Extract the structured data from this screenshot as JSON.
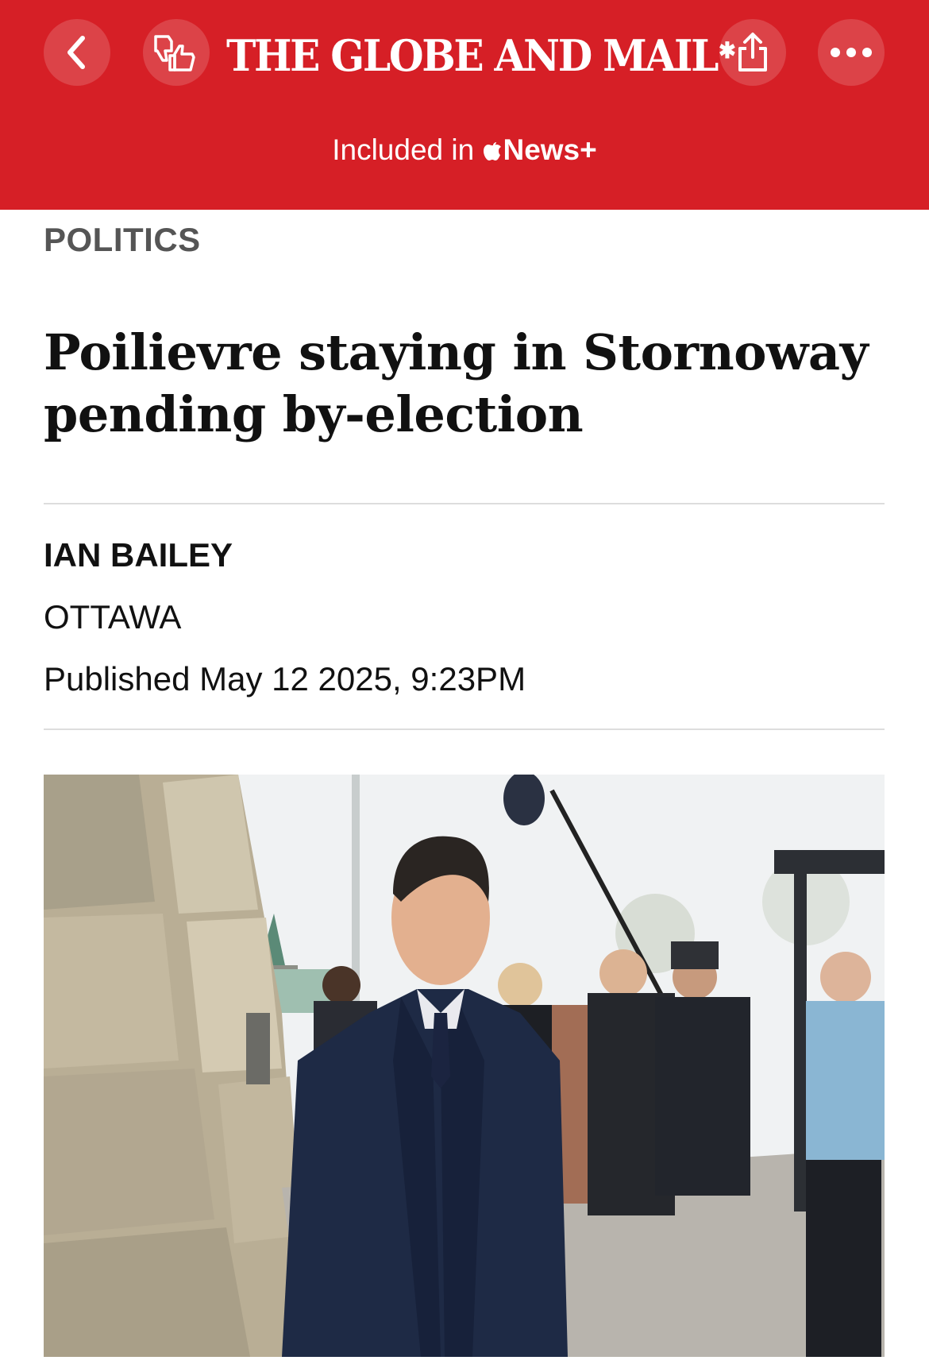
{
  "header": {
    "masthead": "THE GLOBE AND MAIL",
    "included_text": "Included in",
    "included_brand": "News+",
    "brand_color": "#d61f26",
    "icons": [
      "chevron-left-icon",
      "thumbs-reaction-icon",
      "share-icon",
      "more-icon"
    ]
  },
  "article": {
    "category": "POLITICS",
    "headline": "Poilievre staying in Stornoway pending by-election",
    "author": "IAN BAILEY",
    "dateline": "OTTAWA",
    "published": "Published May 12 2025, 9:23PM"
  }
}
